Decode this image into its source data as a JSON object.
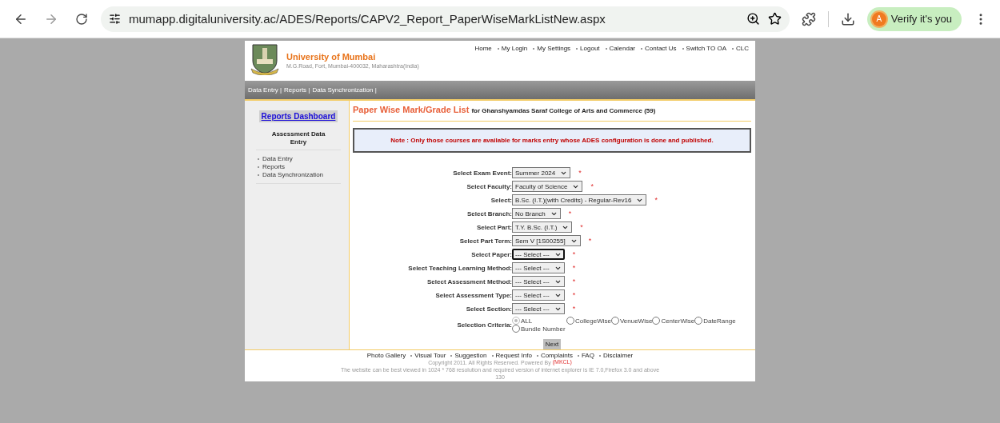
{
  "browser": {
    "url": "mumapp.digitaluniversity.ac/ADES/Reports/CAPV2_Report_PaperWiseMarkListNew.aspx",
    "profile_initial": "A",
    "profile_label": "Verify it's you"
  },
  "header": {
    "title": "University of Mumbai",
    "address": "M.G.Road, Fort, Mumbai-400032, Maharashtra(India)",
    "top_links": [
      "Home",
      "My Login",
      "My Settings",
      "Logout",
      "Calendar",
      "Contact Us",
      "Switch TO OA",
      "CLC"
    ]
  },
  "nav_bar": {
    "items": [
      "Data Entry |",
      "Reports |",
      "Data Synchronization |"
    ]
  },
  "sidebar": {
    "dashboard_button": "Reports Dashboard",
    "section_title": "Assessment Data Entry",
    "links": [
      "Data Entry",
      "Reports",
      "Data Synchronization"
    ]
  },
  "content": {
    "title": "Paper Wise Mark/Grade List",
    "subtitle": "for Ghanshyamdas Saraf College of Arts and Commerce (59)",
    "note": "Note : Only those courses are available for marks entry whose ADES configuration is done and published.",
    "fields": [
      {
        "label": "Select Exam Event:",
        "value": "Summer 2024",
        "mark": "*",
        "focused": false
      },
      {
        "label": "Select Faculty:",
        "value": "Faculty of Science",
        "mark": "*",
        "focused": false
      },
      {
        "label": "Select:",
        "value": "B.Sc. (I.T.)(with Credits) - Regular-Rev16",
        "mark": "*",
        "focused": false
      },
      {
        "label": "Select Branch:",
        "value": "No Branch",
        "mark": "*",
        "focused": false
      },
      {
        "label": "Select Part:",
        "value": "T.Y. B.Sc. (I.T.)",
        "mark": "*",
        "focused": false
      },
      {
        "label": "Select Part Term:",
        "value": "Sem V [1S00255]",
        "mark": "*",
        "focused": false
      },
      {
        "label": "Select Paper:",
        "value": "--- Select ---",
        "mark": "*",
        "focused": true
      },
      {
        "label": "Select Teaching Learning Method:",
        "value": "--- Select ---",
        "mark": "*",
        "focused": false
      },
      {
        "label": "Select Assessment Method:",
        "value": "--- Select ---",
        "mark": "*",
        "focused": false
      },
      {
        "label": "Select Assessment Type:",
        "value": "--- Select ---",
        "mark": "*",
        "focused": false
      },
      {
        "label": "Select Section:",
        "value": "--- Select ---",
        "mark": "*",
        "focused": false
      }
    ],
    "criteria": {
      "label": "Selection Criteria:",
      "options": [
        {
          "label": "ALL",
          "selected": true
        },
        {
          "label": "CollegeWise",
          "selected": false
        },
        {
          "label": "VenueWise",
          "selected": false
        },
        {
          "label": "CenterWise",
          "selected": false
        },
        {
          "label": "DateRange",
          "selected": false
        },
        {
          "label": "Bundle Number",
          "selected": false
        }
      ]
    },
    "next_button": "Next"
  },
  "footer": {
    "links": [
      "Photo Gallery",
      "Visual Tour",
      "Suggestion",
      "Request Info",
      "Complaints",
      "FAQ",
      "Disclaimer"
    ],
    "copyright": "Copyright 2011. All Rights Reserved. Powered By",
    "powered_link": "(MKCL)",
    "browser_note": "The website can be best viewed in 1024 * 768 resolution and required version of internet explorer is IE 7.0,Firefox 3.0 and above",
    "counter": "130"
  }
}
